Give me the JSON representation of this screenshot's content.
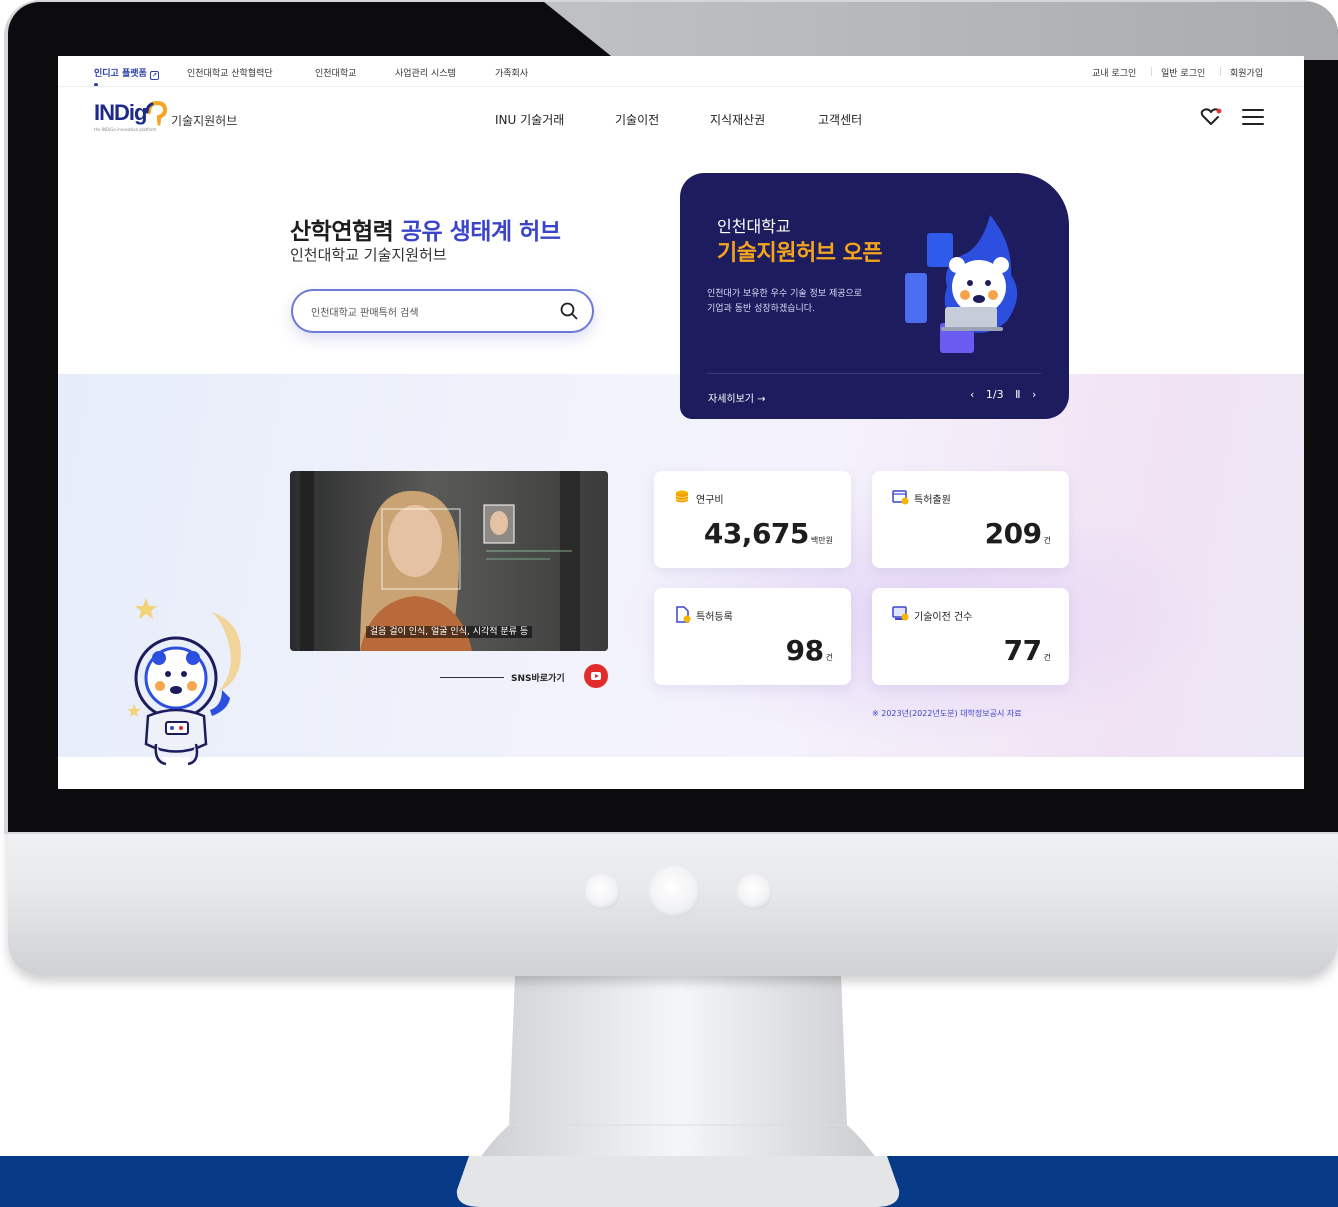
{
  "utility_nav": {
    "platform_label": "인디고 플랫폼",
    "items": [
      "인천대학교 산학협력단",
      "인천대학교",
      "사업관리 시스템",
      "가족회사"
    ],
    "auth": [
      "교내 로그인",
      "일반 로그인",
      "회원가입"
    ]
  },
  "brand": {
    "logo_text": "INDig",
    "logo_sub": "the INDiGo innovation platform",
    "name": "기술지원허브"
  },
  "main_nav": [
    "INU 기술거래",
    "기술이전",
    "지식재산권",
    "고객센터"
  ],
  "hero": {
    "title_plain": "산학연협력 ",
    "title_accent": "공유 생태계 허브",
    "subtitle": "인천대학교 기술지원허브",
    "search_placeholder": "인천대학교 판매특허 검색"
  },
  "banner": {
    "eyebrow": "인천대학교",
    "title": "기술지원허브 오픈",
    "desc_line1": "인천대가 보유한 우수 기술 정보 제공으로",
    "desc_line2": "기업과 동반 성장하겠습니다.",
    "more": "자세히보기 →",
    "pager": "1/3"
  },
  "video": {
    "caption": "걸음 걸이 인식, 얼굴 인식, 시각적 분류 등",
    "sns_label": "SNS바로가기"
  },
  "stats": [
    {
      "label": "연구비",
      "value": "43,675",
      "unit": "백만원",
      "icon": "coin-stack-icon"
    },
    {
      "label": "특허출원",
      "value": "209",
      "unit": "건",
      "icon": "patent-filing-icon"
    },
    {
      "label": "특허등록",
      "value": "98",
      "unit": "건",
      "icon": "patent-registration-icon"
    },
    {
      "label": "기술이전 건수",
      "value": "77",
      "unit": "건",
      "icon": "tech-transfer-icon"
    }
  ],
  "source_note": "※ 2023년(2022년도분) 대학정보공시 자료",
  "colors": {
    "brand_navy": "#1c1c5e",
    "accent_blue": "#3a45c9",
    "banner_orange": "#f4a51c",
    "bottom_band": "#063a86",
    "youtube_red": "#e22c2c"
  }
}
